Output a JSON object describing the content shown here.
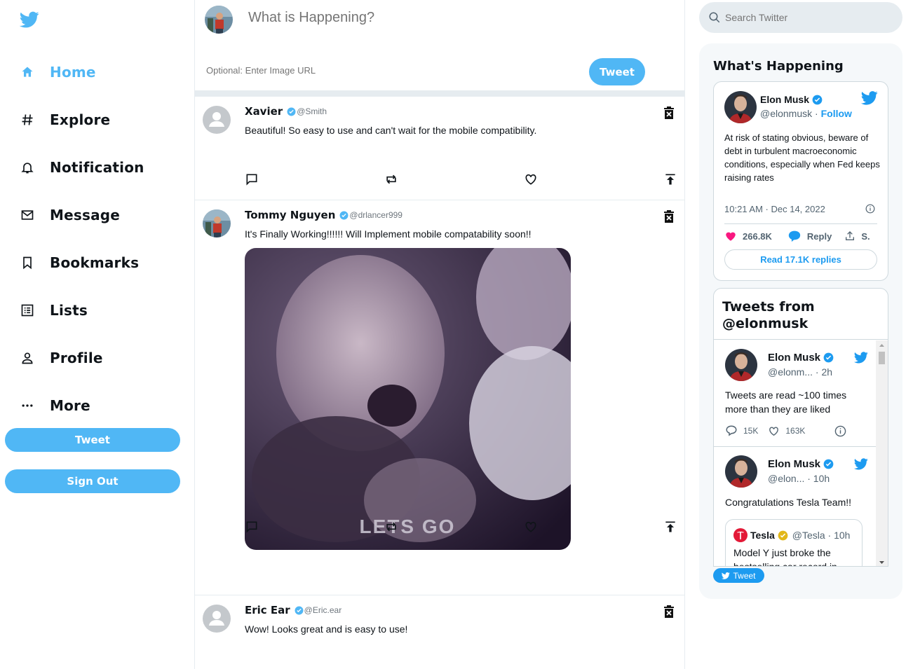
{
  "sidebar": {
    "items": [
      {
        "label": "Home",
        "icon": "home-icon"
      },
      {
        "label": "Explore",
        "icon": "hashtag-icon"
      },
      {
        "label": "Notification",
        "icon": "bell-icon"
      },
      {
        "label": "Message",
        "icon": "mail-icon"
      },
      {
        "label": "Bookmarks",
        "icon": "bookmark-icon"
      },
      {
        "label": "Lists",
        "icon": "list-icon"
      },
      {
        "label": "Profile",
        "icon": "person-icon"
      },
      {
        "label": "More",
        "icon": "more-icon"
      }
    ],
    "tweet_label": "Tweet",
    "signout_label": "Sign Out"
  },
  "composer": {
    "placeholder": "What is Happening?",
    "image_placeholder": "Optional: Enter Image URL",
    "tweet_label": "Tweet"
  },
  "posts": [
    {
      "name": "Xavier",
      "handle": "@Smith",
      "text": "Beautiful! So easy to use and can't wait for the mobile compatibility.",
      "avatar": "default"
    },
    {
      "name": "Tommy Nguyen",
      "handle": "@drlancer999",
      "text": "It's Finally Working!!!!!! Will Implement mobile compatability soon!!",
      "avatar": "photo",
      "media_caption": "LETS GO"
    },
    {
      "name": "Eric Ear",
      "handle": "@Eric.ear",
      "text": "Wow! Looks great and is easy to use!",
      "avatar": "default"
    }
  ],
  "search": {
    "placeholder": "Search Twitter"
  },
  "widgets": {
    "title": "What's Happening",
    "card": {
      "name": "Elon Musk",
      "handle": "@elonmusk",
      "separator": "·",
      "follow": "Follow",
      "text": "At risk of stating obvious, beware of debt in turbulent macroeconomic conditions, especially when Fed keeps raising rates",
      "time": "10:21 AM · Dec 14, 2022",
      "likes": "266.8K",
      "reply": "Reply",
      "share": "S.",
      "read_replies": "Read 17.1K replies"
    },
    "timeline": {
      "title": "Tweets from @elonmusk",
      "tweets": [
        {
          "name": "Elon Musk",
          "handle": "@elonm...",
          "time": "· 2h",
          "text": "Tweets are read ~100 times more than they are liked",
          "replies": "15K",
          "likes": "163K"
        },
        {
          "name": "Elon Musk",
          "handle": "@elon...",
          "time": "· 10h",
          "text": "Congratulations Tesla Team!!",
          "quote_name": "Tesla",
          "quote_handle": "@Tesla · 10h",
          "quote_text": "Model Y just broke the bestselling car record in"
        }
      ]
    },
    "embed_tweet_label": "Tweet"
  },
  "colors": {
    "accent": "#50b7f5",
    "twitter_blue": "#1d9bf0",
    "like_pink": "#f91880",
    "gold": "#e2b719",
    "tesla_red": "#e31937"
  }
}
